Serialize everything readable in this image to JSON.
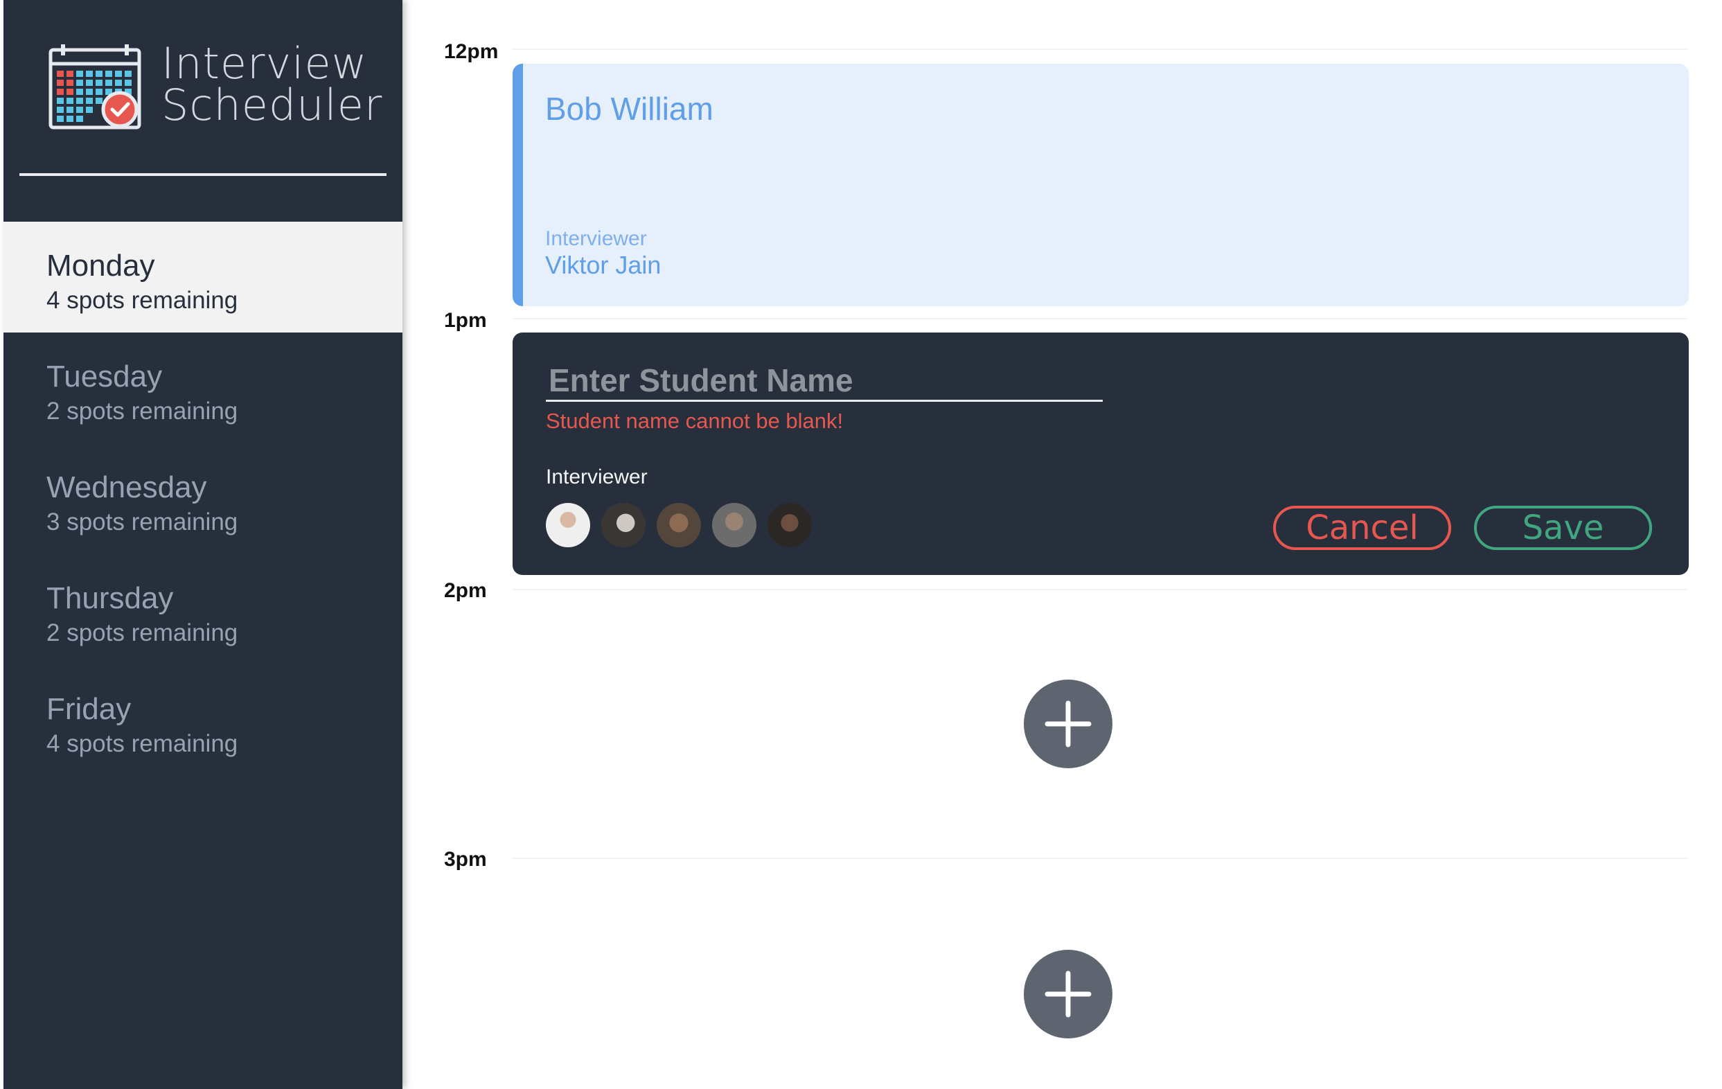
{
  "app": {
    "title_line1": "Interview",
    "title_line2": "Scheduler"
  },
  "days": [
    {
      "name": "Monday",
      "spots": "4 spots remaining",
      "selected": true
    },
    {
      "name": "Tuesday",
      "spots": "2 spots remaining",
      "selected": false
    },
    {
      "name": "Wednesday",
      "spots": "3 spots remaining",
      "selected": false
    },
    {
      "name": "Thursday",
      "spots": "2 spots remaining",
      "selected": false
    },
    {
      "name": "Friday",
      "spots": "4 spots remaining",
      "selected": false
    }
  ],
  "times": [
    "12pm",
    "1pm",
    "2pm",
    "3pm"
  ],
  "booked": {
    "student": "Bob William",
    "interviewer_label": "Interviewer",
    "interviewer": "Viktor Jain"
  },
  "form": {
    "placeholder": "Enter Student Name",
    "value": "",
    "error": "Student name cannot be blank!",
    "interviewer_label": "Interviewer",
    "cancel": "Cancel",
    "save": "Save"
  },
  "colors": {
    "sidebar_bg": "#272f3d",
    "accent_blue": "#5f9ee8",
    "error_red": "#e6584f",
    "save_green": "#3fa67f",
    "add_button": "#5e6470"
  }
}
